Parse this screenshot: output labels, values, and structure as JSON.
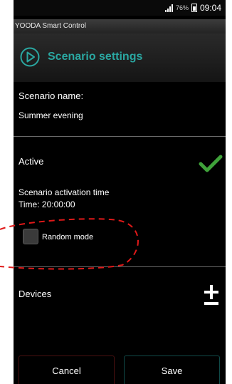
{
  "status_bar": {
    "battery_percent": "76%",
    "time": "09:04"
  },
  "app_title": "YOODA Smart Control",
  "header": {
    "title": "Scenario settings",
    "icon": "play-circle-icon",
    "accent_color": "#2aa7a1"
  },
  "scenario": {
    "name_label": "Scenario name:",
    "name_value": "Summer evening"
  },
  "active": {
    "label": "Active",
    "checked": true,
    "check_color": "#3fa23a"
  },
  "activation": {
    "title": "Scenario activation time",
    "time_text": "Time: 20:00:00"
  },
  "random_mode": {
    "label": "Random mode",
    "checked": false
  },
  "devices": {
    "label": "Devices",
    "add_icon": "add-icon"
  },
  "buttons": {
    "cancel": "Cancel",
    "save": "Save"
  },
  "annotation_color": "#e01919"
}
